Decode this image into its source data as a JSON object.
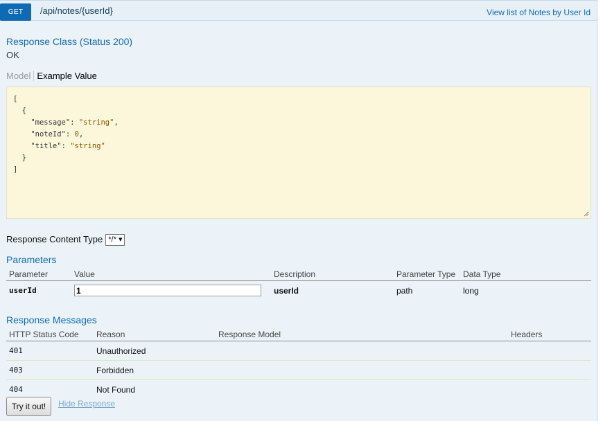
{
  "operation": {
    "verb": "GET",
    "path": "/api/notes/{userId}",
    "summary": "View list of Notes by User Id"
  },
  "response_class": {
    "heading": "Response Class (Status 200)",
    "status_text": "OK",
    "tab_model": "Model",
    "tab_example": "Example Value"
  },
  "example_json": {
    "open_bracket": "[",
    "open_brace": "{",
    "line1_key": "\"message\"",
    "line1_val": "\"string\"",
    "line2_key": "\"noteId\"",
    "line2_val": "0",
    "line3_key": "\"title\"",
    "line3_val": "\"string\"",
    "close_brace": "}",
    "close_bracket": "]"
  },
  "content_type": {
    "label": "Response Content Type",
    "selected": "*/*"
  },
  "parameters": {
    "heading": "Parameters",
    "headers": [
      "Parameter",
      "Value",
      "Description",
      "Parameter Type",
      "Data Type"
    ],
    "row": {
      "name": "userId",
      "value": "1",
      "description": "userId",
      "param_type": "path",
      "data_type": "long"
    }
  },
  "response_messages": {
    "heading": "Response Messages",
    "headers": [
      "HTTP Status Code",
      "Reason",
      "Response Model",
      "Headers"
    ],
    "rows": [
      {
        "code": "401",
        "reason": "Unauthorized"
      },
      {
        "code": "403",
        "reason": "Forbidden"
      },
      {
        "code": "404",
        "reason": "Not Found"
      }
    ]
  },
  "actions": {
    "try_label": "Try it out!",
    "hide_label": "Hide Response"
  },
  "colors": {
    "accent": "#0f6ab4",
    "panel_bg": "#ebf3f9",
    "snippet_bg": "#fcf6db"
  }
}
